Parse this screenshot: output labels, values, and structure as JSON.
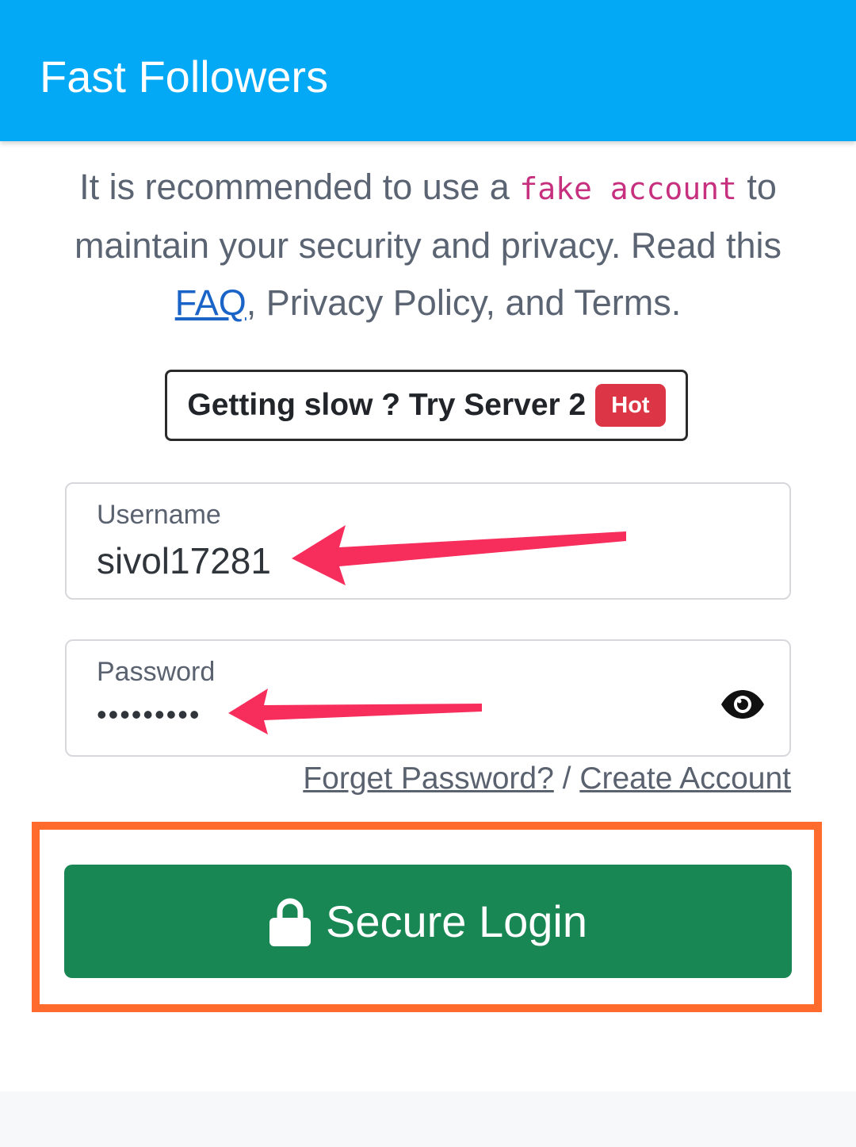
{
  "appbar": {
    "title": "Fast Followers",
    "color": "#03a9f4"
  },
  "notice": {
    "text_before": "It is recommended to use a ",
    "code": "fake account",
    "text_middle": " to maintain your security and privacy. Read this ",
    "faq_link": "FAQ",
    "text_after": ", Privacy Policy, and Terms."
  },
  "server_button": {
    "label": "Getting slow ? Try Server 2",
    "badge": "Hot"
  },
  "username": {
    "label": "Username",
    "value": "sivol17281"
  },
  "password": {
    "label": "Password",
    "value": "•••••••••",
    "toggle_icon": "eye-icon"
  },
  "links": {
    "forget": "Forget Password?",
    "separator": "/",
    "create": "Create Account"
  },
  "login_button": {
    "label": "Secure Login",
    "icon": "lock-icon",
    "color": "#198754"
  },
  "annotations": {
    "arrow_color": "#f72d5c",
    "highlight_color": "#ff6b2c"
  }
}
